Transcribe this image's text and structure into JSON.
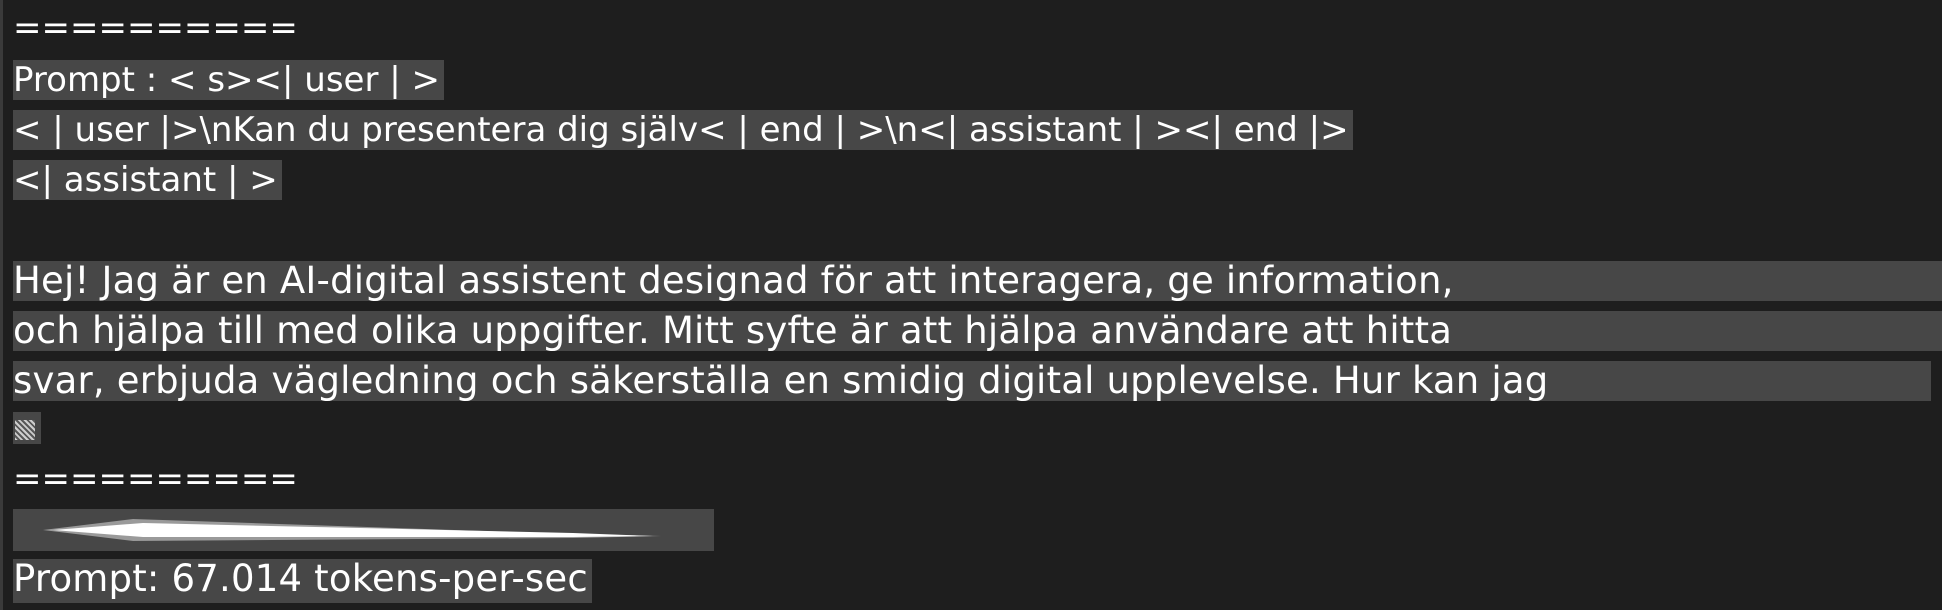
{
  "terminal": {
    "separator_top": "==========",
    "prompt_line_1": "Prompt : < s><| user | >",
    "prompt_line_2": "< | user |>\\nKan du presentera dig själv< | end | >\\n<| assistant | ><| end |>",
    "prompt_line_3": "<| assistant | >",
    "response_line_1": "Hej! Jag är en AI-digital assistent designad för att interagera, ge information,",
    "response_line_2": "och hjälpa till med olika uppgifter. Mitt syfte är att hjälpa användare att hitta",
    "response_line_3": "svar, erbjuda vägledning och säkerställa en smidig digital upplevelse. Hur kan jag",
    "separator_bottom": "==========",
    "stats_line": "Prompt: 67.014 tokens-per-sec"
  }
}
